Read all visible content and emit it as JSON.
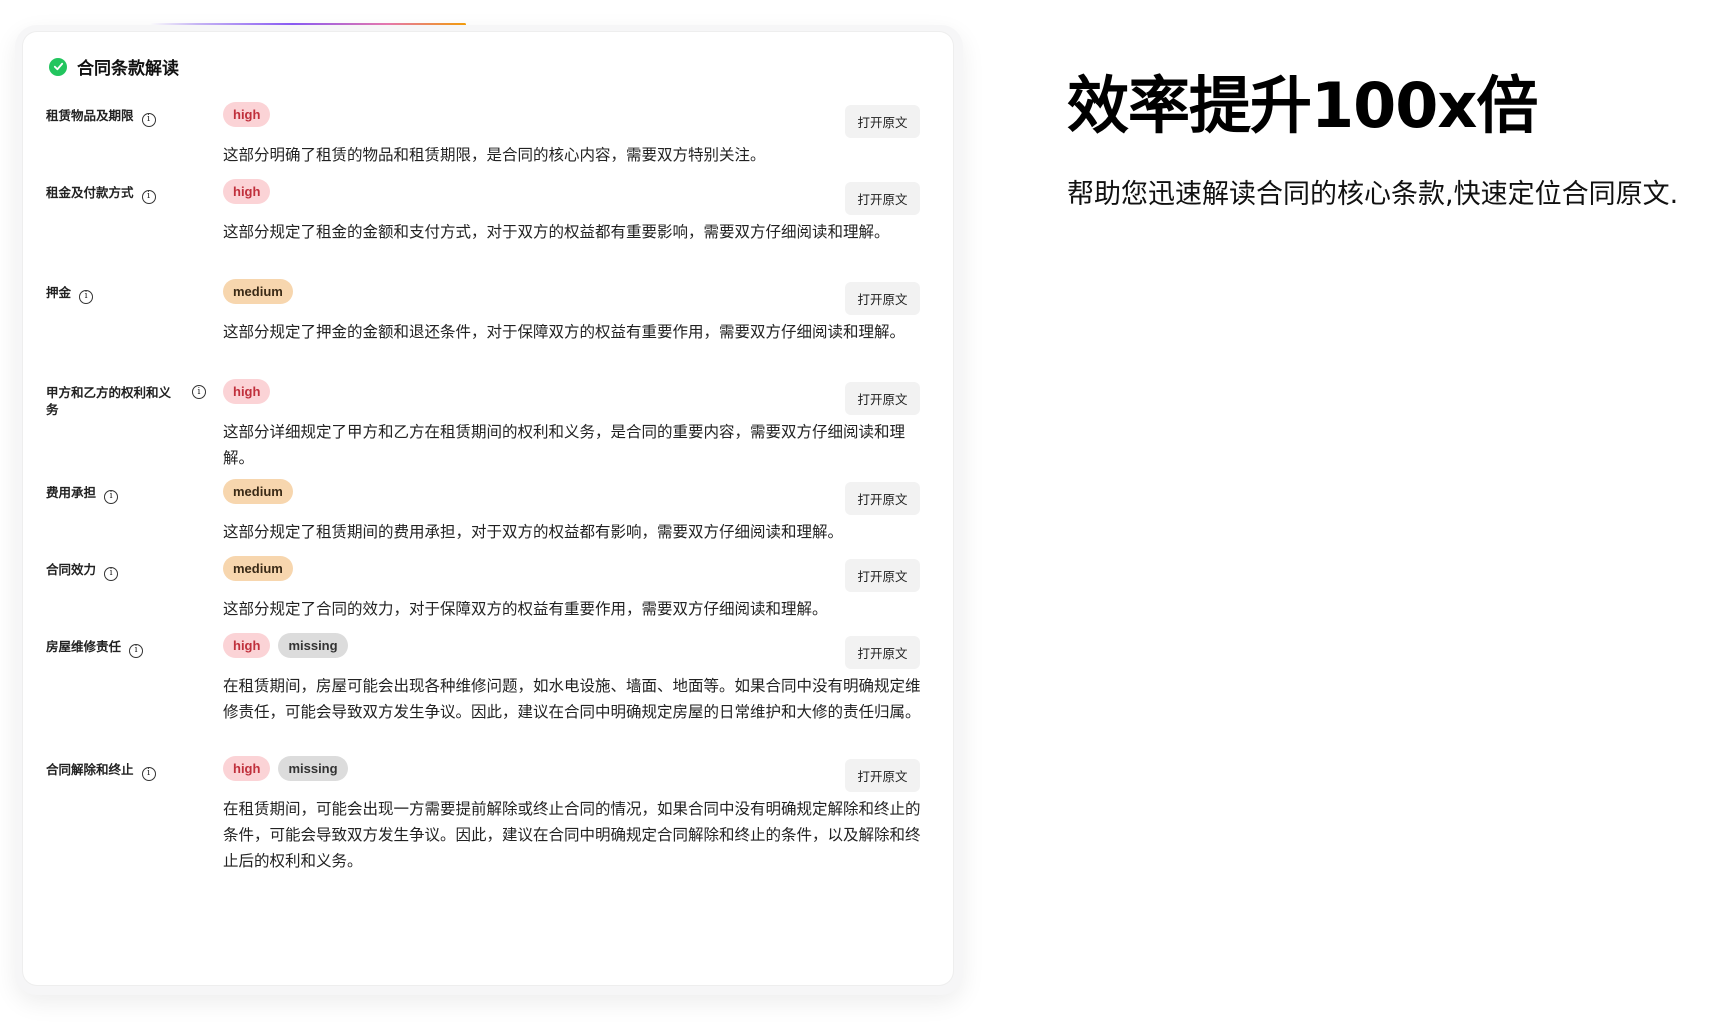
{
  "card": {
    "title": "合同条款解读",
    "open_label": "打开原文",
    "clauses": [
      {
        "label": "租赁物品及期限",
        "badges": [
          "high"
        ],
        "desc": "这部分明确了租赁的物品和租赁期限，是合同的核心内容，需要双方特别关注。"
      },
      {
        "label": "租金及付款方式",
        "badges": [
          "high"
        ],
        "desc": "这部分规定了租金的金额和支付方式，对于双方的权益都有重要影响，需要双方仔细阅读和理解。"
      },
      {
        "label": "押金",
        "badges": [
          "medium"
        ],
        "desc": "这部分规定了押金的金额和退还条件，对于保障双方的权益有重要作用，需要双方仔细阅读和理解。"
      },
      {
        "label": "甲方和乙方的权利和义务",
        "badges": [
          "high"
        ],
        "desc": "这部分详细规定了甲方和乙方在租赁期间的权利和义务，是合同的重要内容，需要双方仔细阅读和理解。"
      },
      {
        "label": "费用承担",
        "badges": [
          "medium"
        ],
        "desc": "这部分规定了租赁期间的费用承担，对于双方的权益都有影响，需要双方仔细阅读和理解。"
      },
      {
        "label": "合同效力",
        "badges": [
          "medium"
        ],
        "desc": "这部分规定了合同的效力，对于保障双方的权益有重要作用，需要双方仔细阅读和理解。"
      },
      {
        "label": "房屋维修责任",
        "badges": [
          "high",
          "missing"
        ],
        "desc": "在租赁期间，房屋可能会出现各种维修问题，如水电设施、墙面、地面等。如果合同中没有明确规定维修责任，可能会导致双方发生争议。因此，建议在合同中明确规定房屋的日常维护和大修的责任归属。"
      },
      {
        "label": "合同解除和终止",
        "badges": [
          "high",
          "missing"
        ],
        "desc": "在租赁期间，可能会出现一方需要提前解除或终止合同的情况，如果合同中没有明确规定解除和终止的条件，可能会导致双方发生争议。因此，建议在合同中明确规定合同解除和终止的条件，以及解除和终止后的权利和义务。"
      }
    ]
  },
  "hero": {
    "title": "效率提升100x倍",
    "subtitle": "帮助您迅速解读合同的核心条款,快速定位合同原文."
  },
  "colors": {
    "high_bg": "#fbd3d6",
    "high_text": "#c0303c",
    "medium_bg": "#f7d6ae",
    "missing_bg": "#dcdcdc",
    "check_green": "#22c55e"
  },
  "icons": {
    "header": "check-circle-icon",
    "info": "info-icon"
  }
}
